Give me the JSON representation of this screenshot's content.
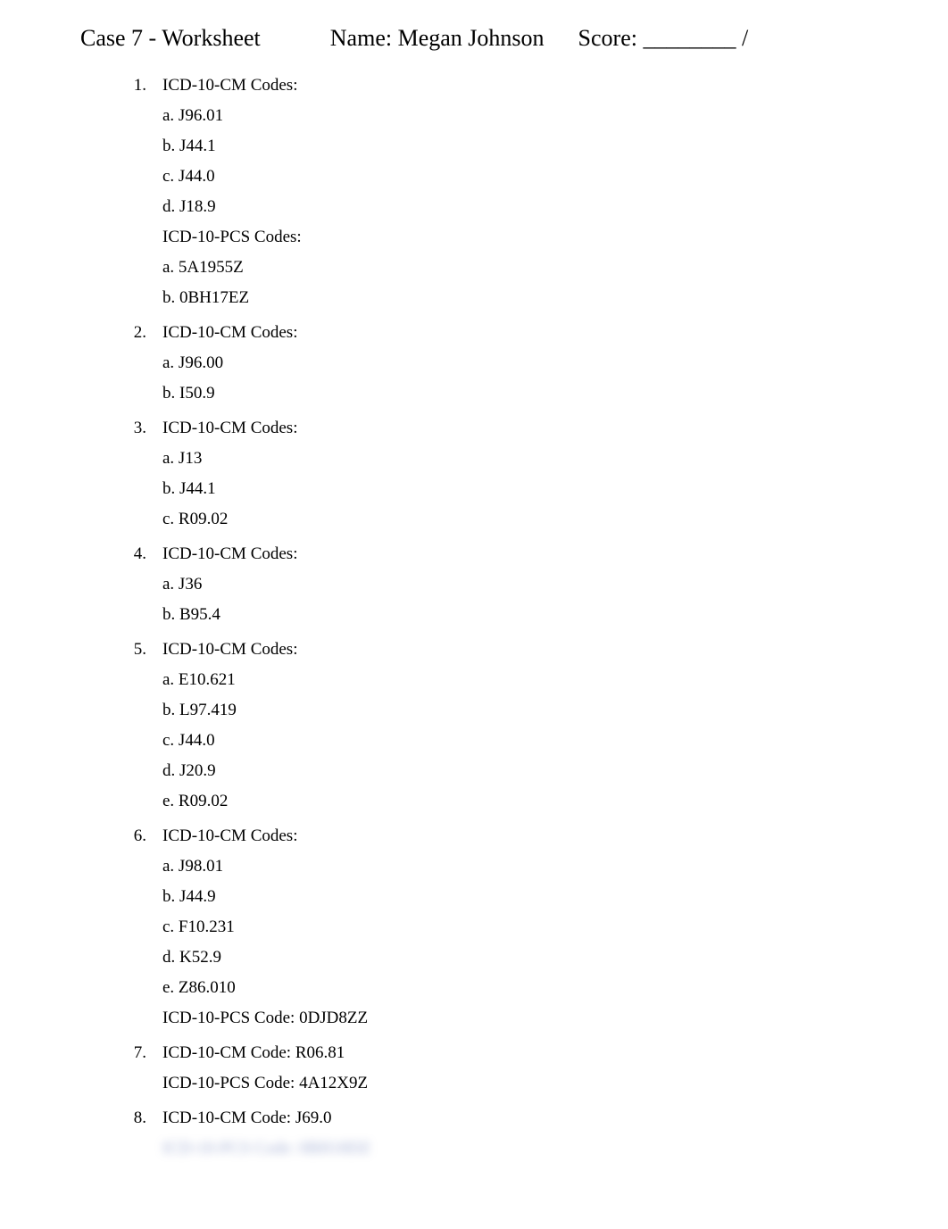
{
  "header": {
    "title": "Case 7 - Worksheet",
    "nameLabel": "Name:",
    "nameValue": "Megan Johnson",
    "scoreLabel": "Score:",
    "scoreBlank": "________",
    "scoreSuffix": "/"
  },
  "items": [
    {
      "num": "1.",
      "groups": [
        {
          "heading": "ICD-10-CM Codes:",
          "subs": [
            "a. J96.01",
            "b. J44.1",
            "c. J44.0",
            "d. J18.9"
          ]
        },
        {
          "heading": "ICD-10-PCS Codes:",
          "subs": [
            "a. 5A1955Z",
            "b. 0BH17EZ"
          ]
        }
      ]
    },
    {
      "num": "2.",
      "groups": [
        {
          "heading": "ICD-10-CM Codes:",
          "subs": [
            "a. J96.00",
            "b. I50.9"
          ]
        }
      ]
    },
    {
      "num": "3.",
      "groups": [
        {
          "heading": "ICD-10-CM Codes:",
          "subs": [
            "a. J13",
            "b. J44.1",
            "c. R09.02"
          ]
        }
      ]
    },
    {
      "num": "4.",
      "groups": [
        {
          "heading": "ICD-10-CM Codes:",
          "subs": [
            "a. J36",
            "b. B95.4"
          ]
        }
      ]
    },
    {
      "num": "5.",
      "groups": [
        {
          "heading": "ICD-10-CM Codes:",
          "subs": [
            "a. E10.621",
            "b. L97.419",
            "c. J44.0",
            "d. J20.9",
            "e. R09.02"
          ]
        }
      ]
    },
    {
      "num": "6.",
      "groups": [
        {
          "heading": "ICD-10-CM Codes:",
          "subs": [
            "a. J98.01",
            "b. J44.9",
            "c. F10.231",
            "d. K52.9",
            "e. Z86.010"
          ]
        },
        {
          "inline": "ICD-10-PCS Code: 0DJD8ZZ"
        }
      ]
    },
    {
      "num": "7.",
      "groups": [
        {
          "inline": "ICD-10-CM Code: R06.81"
        },
        {
          "inline": "ICD-10-PCS Code: 4A12X9Z"
        }
      ]
    },
    {
      "num": "8.",
      "groups": [
        {
          "inline": "ICD-10-CM Code: J69.0"
        },
        {
          "blurred": "ICD-10-PCS Code: 0BH18DZ"
        }
      ]
    }
  ]
}
